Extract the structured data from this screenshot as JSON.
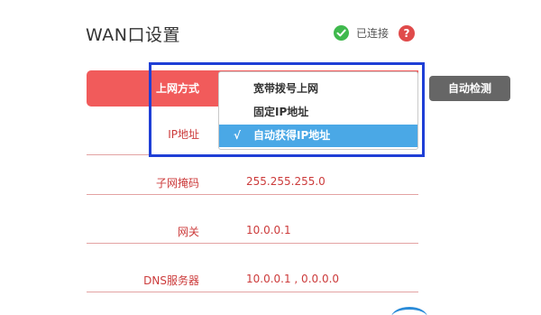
{
  "header": {
    "title": "WAN口设置",
    "status_text": "已连接",
    "help_glyph": "?"
  },
  "connection": {
    "label": "上网方式",
    "detect_button": "自动检测",
    "options": [
      "宽带拨号上网",
      "固定IP地址",
      "自动获得IP地址"
    ],
    "selected_index": 2,
    "check_mark": "√"
  },
  "fields": [
    {
      "label": "IP地址",
      "value": ""
    },
    {
      "label": "子网掩码",
      "value": "255.255.255.0"
    },
    {
      "label": "网关",
      "value": "10.0.0.1"
    },
    {
      "label": "DNS服务器",
      "value": "10.0.0.1 , 0.0.0.0"
    }
  ],
  "colors": {
    "accent_red": "#f15b5b",
    "label_red": "#cc3b3b",
    "selected_blue": "#4aa8e6",
    "highlight_blue": "#1f3fd6",
    "ok_green": "#3fb94d"
  },
  "icons": {
    "status": "check-circle-icon",
    "help": "question-circle-icon"
  }
}
